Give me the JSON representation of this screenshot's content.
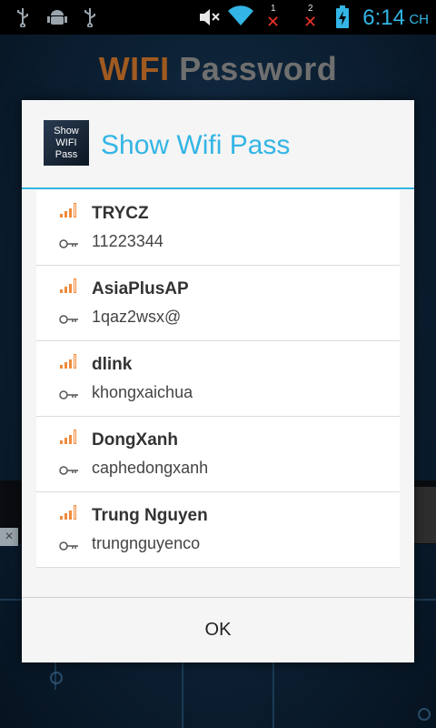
{
  "status_bar": {
    "time": "6:14",
    "carrier_suffix": "CH",
    "sim1_label": "1",
    "sim2_label": "2",
    "icons": [
      "usb-icon",
      "android-debug-icon",
      "usb-icon",
      "mute-icon",
      "wifi-icon",
      "sim1-no-signal-icon",
      "sim2-no-signal-icon",
      "battery-charging-icon"
    ]
  },
  "background": {
    "title_part1": "WIFI",
    "title_part2": "Password"
  },
  "dialog": {
    "icon_text": [
      "Show",
      "WIFI",
      "Pass"
    ],
    "title": "Show Wifi Pass",
    "ok_label": "OK",
    "accent_color": "#33b5e5",
    "signal_color": "#f08a3a"
  },
  "networks": [
    {
      "ssid": "TRYCZ",
      "password": "11223344"
    },
    {
      "ssid": "AsiaPlusAP",
      "password": "1qaz2wsx@"
    },
    {
      "ssid": "dlink",
      "password": "khongxaichua"
    },
    {
      "ssid": "DongXanh",
      "password": "caphedongxanh"
    },
    {
      "ssid": "Trung Nguyen",
      "password": "trungnguyenco"
    }
  ]
}
